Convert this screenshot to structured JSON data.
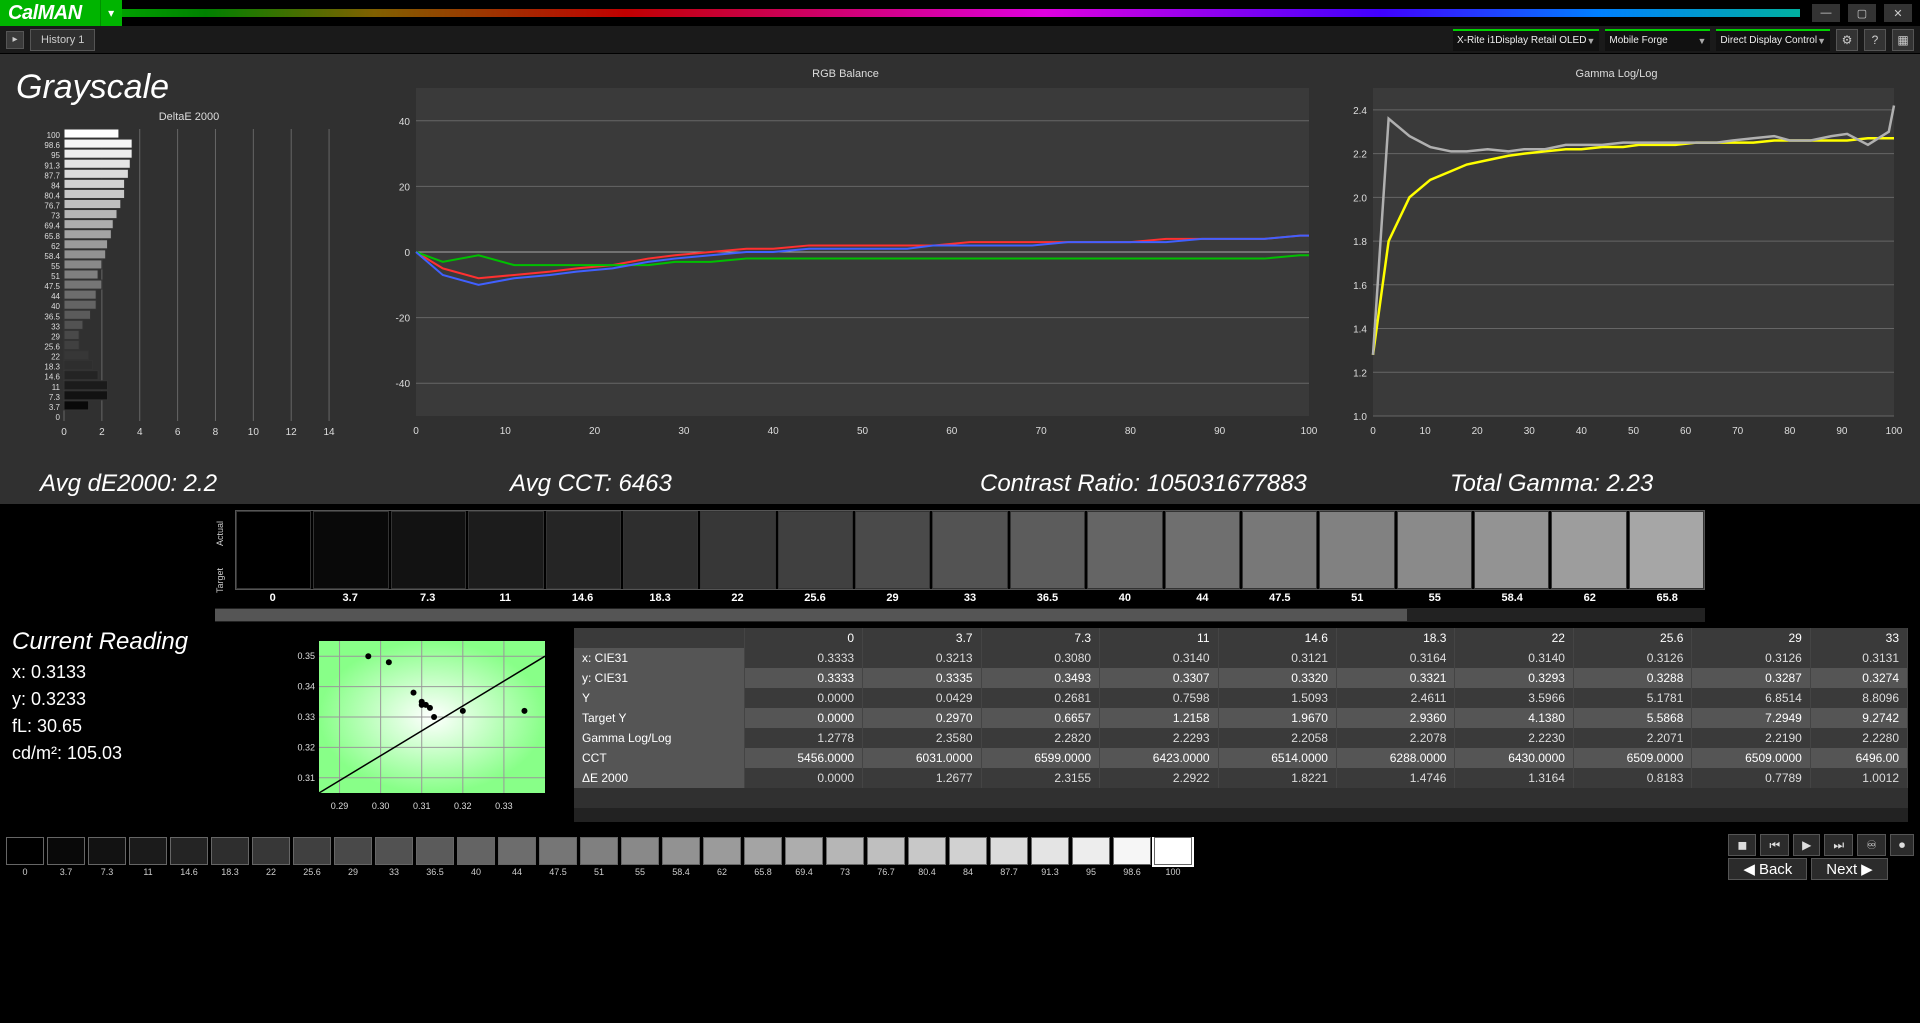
{
  "app": {
    "logo": "CalMAN",
    "tab": "History 1"
  },
  "toolbar": {
    "meter": "X-Rite i1Display Retail OLED",
    "source": "Mobile Forge",
    "display": "Direct Display Control"
  },
  "page": {
    "title": "Grayscale"
  },
  "stats": {
    "avg_de": "Avg dE2000: 2.2",
    "avg_cct": "Avg CCT: 6463",
    "contrast": "Contrast Ratio: 105031677883",
    "gamma": "Total Gamma: 2.23"
  },
  "swatches": {
    "rows": [
      "Actual",
      "Target"
    ],
    "labels": [
      "0",
      "3.7",
      "7.3",
      "11",
      "14.6",
      "18.3",
      "22",
      "25.6",
      "29",
      "33",
      "36.5",
      "40",
      "44",
      "47.5",
      "51",
      "55",
      "58.4",
      "62",
      "65.8"
    ]
  },
  "reading": {
    "title": "Current Reading",
    "x": "x: 0.3133",
    "y": "y: 0.3233",
    "fL": "fL: 30.65",
    "cd": "cd/m²: 105.03"
  },
  "table": {
    "cols": [
      "0",
      "3.7",
      "7.3",
      "11",
      "14.6",
      "18.3",
      "22",
      "25.6",
      "29",
      "33"
    ],
    "rows": [
      {
        "name": "x: CIE31",
        "v": [
          "0.3333",
          "0.3213",
          "0.3080",
          "0.3140",
          "0.3121",
          "0.3164",
          "0.3140",
          "0.3126",
          "0.3126",
          "0.3131"
        ]
      },
      {
        "name": "y: CIE31",
        "v": [
          "0.3333",
          "0.3335",
          "0.3493",
          "0.3307",
          "0.3320",
          "0.3321",
          "0.3293",
          "0.3288",
          "0.3287",
          "0.3274"
        ]
      },
      {
        "name": "Y",
        "v": [
          "0.0000",
          "0.0429",
          "0.2681",
          "0.7598",
          "1.5093",
          "2.4611",
          "3.5966",
          "5.1781",
          "6.8514",
          "8.8096"
        ]
      },
      {
        "name": "Target Y",
        "v": [
          "0.0000",
          "0.2970",
          "0.6657",
          "1.2158",
          "1.9670",
          "2.9360",
          "4.1380",
          "5.5868",
          "7.2949",
          "9.2742"
        ]
      },
      {
        "name": "Gamma Log/Log",
        "v": [
          "1.2778",
          "2.3580",
          "2.2820",
          "2.2293",
          "2.2058",
          "2.2078",
          "2.2230",
          "2.2071",
          "2.2190",
          "2.2280"
        ]
      },
      {
        "name": "CCT",
        "v": [
          "5456.0000",
          "6031.0000",
          "6599.0000",
          "6423.0000",
          "6514.0000",
          "6288.0000",
          "6430.0000",
          "6509.0000",
          "6509.0000",
          "6496.00"
        ]
      },
      {
        "name": "ΔE 2000",
        "v": [
          "0.0000",
          "1.2677",
          "2.3155",
          "2.2922",
          "1.8221",
          "1.4746",
          "1.3164",
          "0.8183",
          "0.7789",
          "1.0012"
        ]
      }
    ]
  },
  "footer": {
    "chips": [
      "0",
      "3.7",
      "7.3",
      "11",
      "14.6",
      "18.3",
      "22",
      "25.6",
      "29",
      "33",
      "36.5",
      "40",
      "44",
      "47.5",
      "51",
      "55",
      "58.4",
      "62",
      "65.8",
      "69.4",
      "73",
      "76.7",
      "80.4",
      "84",
      "87.7",
      "91.3",
      "95",
      "98.6",
      "100"
    ],
    "active_index": 28,
    "back": "Back",
    "next": "Next"
  },
  "chart_data": [
    {
      "type": "bar",
      "title": "DeltaE 2000",
      "orientation": "horizontal",
      "categories": [
        "100",
        "98.6",
        "95",
        "91.3",
        "87.7",
        "84",
        "80.4",
        "76.7",
        "73",
        "69.4",
        "65.8",
        "62",
        "58.4",
        "55",
        "51",
        "47.5",
        "44",
        "40",
        "36.5",
        "33",
        "29",
        "25.6",
        "22",
        "18.3",
        "14.6",
        "11",
        "7.3",
        "3.7",
        "0"
      ],
      "values": [
        2.9,
        3.6,
        3.6,
        3.5,
        3.4,
        3.2,
        3.2,
        3.0,
        2.8,
        2.6,
        2.5,
        2.3,
        2.2,
        2.0,
        1.8,
        2.0,
        1.7,
        1.7,
        1.4,
        1.0,
        0.8,
        0.8,
        1.3,
        1.5,
        1.8,
        2.3,
        2.3,
        1.3,
        0
      ],
      "xlim": [
        0,
        15
      ],
      "xlabel": "",
      "ylabel": ""
    },
    {
      "type": "line",
      "title": "RGB Balance",
      "x": [
        0,
        3,
        7,
        11,
        15,
        18,
        22,
        26,
        29,
        33,
        37,
        40,
        44,
        48,
        51,
        55,
        58,
        62,
        66,
        69,
        73,
        77,
        80,
        84,
        88,
        91,
        95,
        99,
        100
      ],
      "series": [
        {
          "name": "Red",
          "color": "#ff3030",
          "values": [
            0,
            -5,
            -8,
            -7,
            -6,
            -5,
            -4,
            -2,
            -1,
            0,
            1,
            1,
            2,
            2,
            2,
            2,
            2,
            3,
            3,
            3,
            3,
            3,
            3,
            4,
            4,
            4,
            4,
            5,
            5
          ]
        },
        {
          "name": "Green",
          "color": "#00c000",
          "values": [
            0,
            -3,
            -1,
            -4,
            -4,
            -4,
            -4,
            -4,
            -3,
            -3,
            -2,
            -2,
            -2,
            -2,
            -2,
            -2,
            -2,
            -2,
            -2,
            -2,
            -2,
            -2,
            -2,
            -2,
            -2,
            -2,
            -2,
            -1,
            -1
          ]
        },
        {
          "name": "Blue",
          "color": "#4060ff",
          "values": [
            0,
            -7,
            -10,
            -8,
            -7,
            -6,
            -5,
            -3,
            -2,
            -1,
            0,
            0,
            1,
            1,
            1,
            1,
            2,
            2,
            2,
            2,
            3,
            3,
            3,
            3,
            4,
            4,
            4,
            5,
            5
          ]
        }
      ],
      "xlim": [
        0,
        100
      ],
      "ylim": [
        -50,
        50
      ],
      "xlabel": "",
      "ylabel": ""
    },
    {
      "type": "line",
      "title": "Gamma Log/Log",
      "x": [
        0,
        3,
        7,
        11,
        15,
        18,
        22,
        26,
        29,
        33,
        37,
        40,
        44,
        48,
        51,
        55,
        58,
        62,
        66,
        69,
        73,
        77,
        80,
        84,
        88,
        91,
        95,
        99,
        100
      ],
      "series": [
        {
          "name": "Target",
          "color": "#ffff00",
          "values": [
            1.28,
            1.8,
            2.0,
            2.08,
            2.12,
            2.15,
            2.17,
            2.19,
            2.2,
            2.21,
            2.22,
            2.22,
            2.23,
            2.23,
            2.24,
            2.24,
            2.24,
            2.25,
            2.25,
            2.25,
            2.25,
            2.26,
            2.26,
            2.26,
            2.26,
            2.26,
            2.27,
            2.27,
            2.27
          ]
        },
        {
          "name": "Measured",
          "color": "#b0b0b0",
          "values": [
            1.28,
            2.36,
            2.28,
            2.23,
            2.21,
            2.21,
            2.22,
            2.21,
            2.22,
            2.22,
            2.24,
            2.24,
            2.24,
            2.25,
            2.25,
            2.25,
            2.25,
            2.25,
            2.25,
            2.26,
            2.27,
            2.28,
            2.26,
            2.26,
            2.28,
            2.29,
            2.24,
            2.3,
            2.42
          ]
        }
      ],
      "xlim": [
        0,
        100
      ],
      "ylim": [
        1.0,
        2.5
      ],
      "xlabel": "",
      "ylabel": ""
    },
    {
      "type": "scatter",
      "title": "CIE xy",
      "series": [
        {
          "name": "readings",
          "values": [
            [
              0.297,
              0.35
            ],
            [
              0.302,
              0.348
            ],
            [
              0.31,
              0.335
            ],
            [
              0.308,
              0.338
            ],
            [
              0.31,
              0.334
            ],
            [
              0.311,
              0.334
            ],
            [
              0.312,
              0.333
            ],
            [
              0.313,
              0.33
            ],
            [
              0.32,
              0.332
            ],
            [
              0.335,
              0.332
            ]
          ]
        }
      ],
      "xlim": [
        0.285,
        0.34
      ],
      "ylim": [
        0.305,
        0.355
      ]
    }
  ]
}
